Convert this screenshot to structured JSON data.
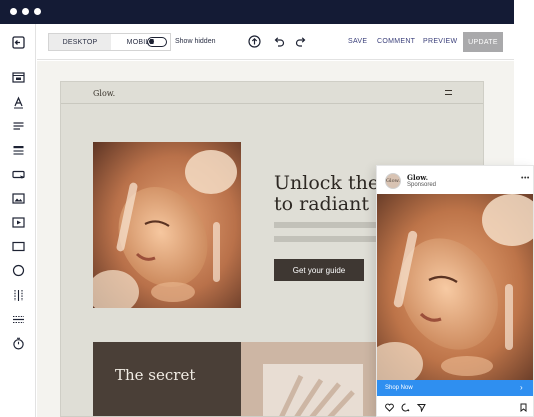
{
  "window": {
    "controls": [
      "window-dot",
      "window-dot",
      "window-dot"
    ]
  },
  "sidebar": {
    "items": [
      {
        "icon": "exit-icon"
      },
      {
        "icon": "section-icon"
      },
      {
        "icon": "text-icon"
      },
      {
        "icon": "paragraph-icon"
      },
      {
        "icon": "list-icon"
      },
      {
        "icon": "button-icon"
      },
      {
        "icon": "image-icon"
      },
      {
        "icon": "video-icon"
      },
      {
        "icon": "container-icon"
      },
      {
        "icon": "circle-icon"
      },
      {
        "icon": "columns-icon"
      },
      {
        "icon": "divider-icon"
      },
      {
        "icon": "timer-icon"
      }
    ]
  },
  "toolbar": {
    "desktop_label": "DESKTOP",
    "mobile_label": "MOBILE",
    "active_view": "DESKTOP",
    "show_hidden_label": "Show hidden",
    "show_hidden_on": false,
    "save_label": "SAVE",
    "comment_label": "COMMENT",
    "preview_label": "PREVIEW",
    "update_label": "UPDATE",
    "icons": [
      "upload-icon",
      "undo-icon",
      "redo-icon"
    ]
  },
  "preview": {
    "brand": "Glow.",
    "headline_line1": "Unlock the",
    "headline_line2": "to radiant s",
    "cta_label": "Get your guide",
    "section_title": "The secret"
  },
  "instagram_card": {
    "avatar_text": "Glow.",
    "account_name": "Glow.",
    "sponsored_label": "Sponsored",
    "more_label": "•••",
    "shop_label": "Shop Now",
    "shop_arrow": "›"
  },
  "colors": {
    "topbar": "#141b35",
    "accent_link": "#3a3f7a",
    "update_button": "#a9a9ab",
    "shop_bar": "#2f8ff0",
    "cta": "#3e3732"
  }
}
